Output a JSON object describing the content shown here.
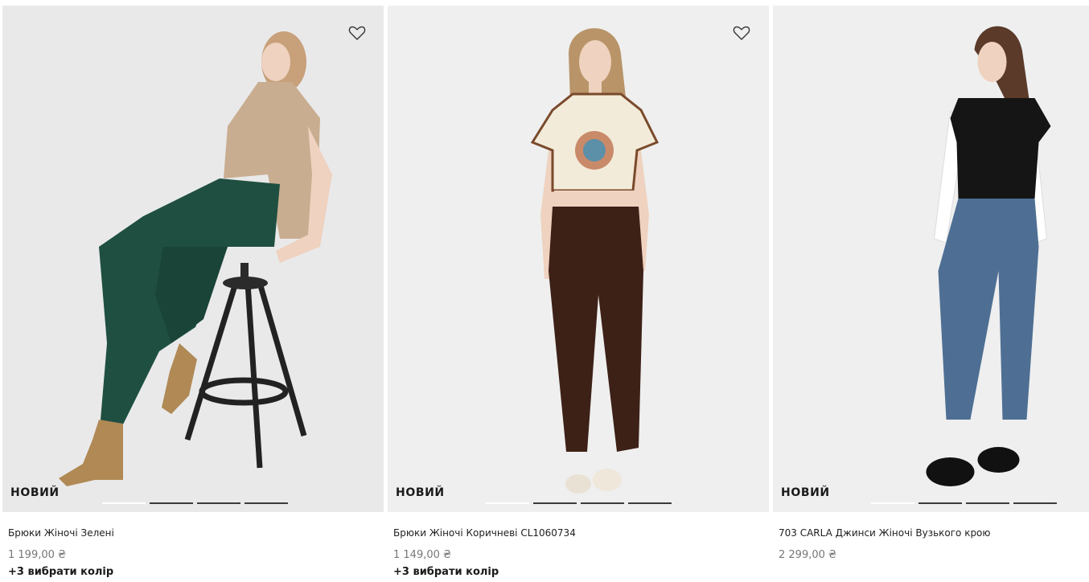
{
  "products": [
    {
      "badge": "НОВИЙ",
      "title": "Брюки Жіночі Зелені",
      "price": "1 199,00 ₴",
      "more_colors": "+3 вибрати колір",
      "favorite_icon": "heart-outline-icon",
      "image_pages": 4,
      "active_page": 1
    },
    {
      "badge": "НОВИЙ",
      "title": "Брюки Жіночі Коричневі CL1060734",
      "price": "1 149,00 ₴",
      "more_colors": "+3 вибрати колір",
      "favorite_icon": "heart-outline-icon",
      "image_pages": 4,
      "active_page": 1
    },
    {
      "badge": "НОВИЙ",
      "title": "703 CARLA Джинси Жіночі Вузького крою",
      "price": "2 299,00 ₴",
      "image_pages": 4,
      "active_page": 1
    }
  ],
  "colors": {
    "badge_text": "#1a1a1a",
    "price_text": "#777777",
    "indicator_active": "#ffffff",
    "indicator_inactive": "#3b3b3b"
  }
}
